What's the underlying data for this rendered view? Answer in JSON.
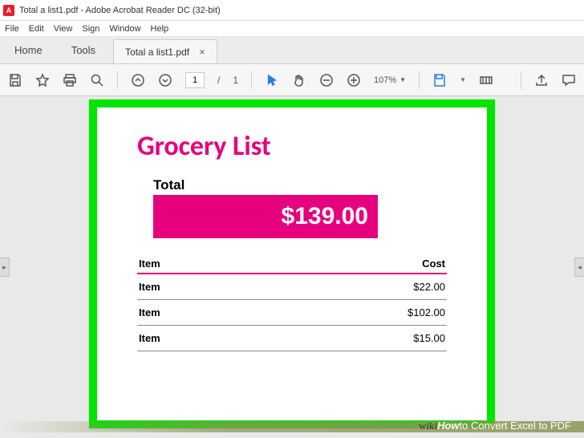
{
  "window": {
    "title": "Total a list1.pdf - Adobe Acrobat Reader DC (32-bit)"
  },
  "menu": [
    "File",
    "Edit",
    "View",
    "Sign",
    "Window",
    "Help"
  ],
  "tabs": {
    "home": "Home",
    "tools": "Tools",
    "current": "Total a list1.pdf"
  },
  "toolbar": {
    "page_current": "1",
    "page_sep": "/",
    "page_total": "1",
    "zoom": "107%"
  },
  "document": {
    "title": "Grocery List",
    "total_label": "Total",
    "total_value": "$139.00",
    "headers": {
      "item": "Item",
      "cost": "Cost"
    },
    "rows": [
      {
        "item": "Item",
        "cost": "$22.00"
      },
      {
        "item": "Item",
        "cost": "$102.00"
      },
      {
        "item": "Item",
        "cost": "$15.00"
      }
    ]
  },
  "watermark": {
    "brand_prefix": "wiki",
    "brand_suffix": "How",
    "text": " to Convert Excel to PDF"
  }
}
